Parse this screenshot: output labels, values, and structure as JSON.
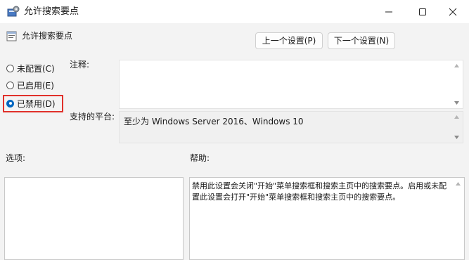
{
  "window": {
    "title": "允许搜索要点",
    "minimize_label": "minimize",
    "maximize_label": "maximize",
    "close_label": "close"
  },
  "header": {
    "setting_name": "允许搜索要点",
    "prev_button": "上一个设置(P)",
    "next_button": "下一个设置(N)"
  },
  "state": {
    "options": [
      {
        "label": "未配置(C)",
        "checked": false
      },
      {
        "label": "已启用(E)",
        "checked": false
      },
      {
        "label": "已禁用(D)",
        "checked": true
      }
    ]
  },
  "comment": {
    "label": "注释:",
    "value": ""
  },
  "platform": {
    "label": "支持的平台:",
    "value": "至少为 Windows Server 2016、Windows 10"
  },
  "options_panel": {
    "label": "选项:"
  },
  "help_panel": {
    "label": "帮助:",
    "text": "禁用此设置会关闭\"开始\"菜单搜索框和搜索主页中的搜索要点。启用或未配置此设置会打开\"开始\"菜单搜索框和搜索主页中的搜索要点。"
  },
  "colors": {
    "accent": "#0067c0",
    "highlight": "#e0302a"
  }
}
